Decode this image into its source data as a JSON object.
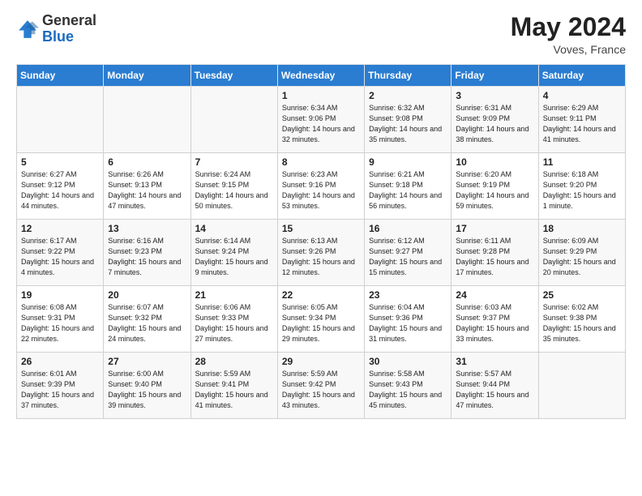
{
  "header": {
    "logo_general": "General",
    "logo_blue": "Blue",
    "month_year": "May 2024",
    "location": "Voves, France"
  },
  "days_of_week": [
    "Sunday",
    "Monday",
    "Tuesday",
    "Wednesday",
    "Thursday",
    "Friday",
    "Saturday"
  ],
  "weeks": [
    [
      {
        "day": null,
        "sunrise": null,
        "sunset": null,
        "daylight": null
      },
      {
        "day": null,
        "sunrise": null,
        "sunset": null,
        "daylight": null
      },
      {
        "day": null,
        "sunrise": null,
        "sunset": null,
        "daylight": null
      },
      {
        "day": 1,
        "sunrise": "Sunrise: 6:34 AM",
        "sunset": "Sunset: 9:06 PM",
        "daylight": "Daylight: 14 hours and 32 minutes."
      },
      {
        "day": 2,
        "sunrise": "Sunrise: 6:32 AM",
        "sunset": "Sunset: 9:08 PM",
        "daylight": "Daylight: 14 hours and 35 minutes."
      },
      {
        "day": 3,
        "sunrise": "Sunrise: 6:31 AM",
        "sunset": "Sunset: 9:09 PM",
        "daylight": "Daylight: 14 hours and 38 minutes."
      },
      {
        "day": 4,
        "sunrise": "Sunrise: 6:29 AM",
        "sunset": "Sunset: 9:11 PM",
        "daylight": "Daylight: 14 hours and 41 minutes."
      }
    ],
    [
      {
        "day": 5,
        "sunrise": "Sunrise: 6:27 AM",
        "sunset": "Sunset: 9:12 PM",
        "daylight": "Daylight: 14 hours and 44 minutes."
      },
      {
        "day": 6,
        "sunrise": "Sunrise: 6:26 AM",
        "sunset": "Sunset: 9:13 PM",
        "daylight": "Daylight: 14 hours and 47 minutes."
      },
      {
        "day": 7,
        "sunrise": "Sunrise: 6:24 AM",
        "sunset": "Sunset: 9:15 PM",
        "daylight": "Daylight: 14 hours and 50 minutes."
      },
      {
        "day": 8,
        "sunrise": "Sunrise: 6:23 AM",
        "sunset": "Sunset: 9:16 PM",
        "daylight": "Daylight: 14 hours and 53 minutes."
      },
      {
        "day": 9,
        "sunrise": "Sunrise: 6:21 AM",
        "sunset": "Sunset: 9:18 PM",
        "daylight": "Daylight: 14 hours and 56 minutes."
      },
      {
        "day": 10,
        "sunrise": "Sunrise: 6:20 AM",
        "sunset": "Sunset: 9:19 PM",
        "daylight": "Daylight: 14 hours and 59 minutes."
      },
      {
        "day": 11,
        "sunrise": "Sunrise: 6:18 AM",
        "sunset": "Sunset: 9:20 PM",
        "daylight": "Daylight: 15 hours and 1 minute."
      }
    ],
    [
      {
        "day": 12,
        "sunrise": "Sunrise: 6:17 AM",
        "sunset": "Sunset: 9:22 PM",
        "daylight": "Daylight: 15 hours and 4 minutes."
      },
      {
        "day": 13,
        "sunrise": "Sunrise: 6:16 AM",
        "sunset": "Sunset: 9:23 PM",
        "daylight": "Daylight: 15 hours and 7 minutes."
      },
      {
        "day": 14,
        "sunrise": "Sunrise: 6:14 AM",
        "sunset": "Sunset: 9:24 PM",
        "daylight": "Daylight: 15 hours and 9 minutes."
      },
      {
        "day": 15,
        "sunrise": "Sunrise: 6:13 AM",
        "sunset": "Sunset: 9:26 PM",
        "daylight": "Daylight: 15 hours and 12 minutes."
      },
      {
        "day": 16,
        "sunrise": "Sunrise: 6:12 AM",
        "sunset": "Sunset: 9:27 PM",
        "daylight": "Daylight: 15 hours and 15 minutes."
      },
      {
        "day": 17,
        "sunrise": "Sunrise: 6:11 AM",
        "sunset": "Sunset: 9:28 PM",
        "daylight": "Daylight: 15 hours and 17 minutes."
      },
      {
        "day": 18,
        "sunrise": "Sunrise: 6:09 AM",
        "sunset": "Sunset: 9:29 PM",
        "daylight": "Daylight: 15 hours and 20 minutes."
      }
    ],
    [
      {
        "day": 19,
        "sunrise": "Sunrise: 6:08 AM",
        "sunset": "Sunset: 9:31 PM",
        "daylight": "Daylight: 15 hours and 22 minutes."
      },
      {
        "day": 20,
        "sunrise": "Sunrise: 6:07 AM",
        "sunset": "Sunset: 9:32 PM",
        "daylight": "Daylight: 15 hours and 24 minutes."
      },
      {
        "day": 21,
        "sunrise": "Sunrise: 6:06 AM",
        "sunset": "Sunset: 9:33 PM",
        "daylight": "Daylight: 15 hours and 27 minutes."
      },
      {
        "day": 22,
        "sunrise": "Sunrise: 6:05 AM",
        "sunset": "Sunset: 9:34 PM",
        "daylight": "Daylight: 15 hours and 29 minutes."
      },
      {
        "day": 23,
        "sunrise": "Sunrise: 6:04 AM",
        "sunset": "Sunset: 9:36 PM",
        "daylight": "Daylight: 15 hours and 31 minutes."
      },
      {
        "day": 24,
        "sunrise": "Sunrise: 6:03 AM",
        "sunset": "Sunset: 9:37 PM",
        "daylight": "Daylight: 15 hours and 33 minutes."
      },
      {
        "day": 25,
        "sunrise": "Sunrise: 6:02 AM",
        "sunset": "Sunset: 9:38 PM",
        "daylight": "Daylight: 15 hours and 35 minutes."
      }
    ],
    [
      {
        "day": 26,
        "sunrise": "Sunrise: 6:01 AM",
        "sunset": "Sunset: 9:39 PM",
        "daylight": "Daylight: 15 hours and 37 minutes."
      },
      {
        "day": 27,
        "sunrise": "Sunrise: 6:00 AM",
        "sunset": "Sunset: 9:40 PM",
        "daylight": "Daylight: 15 hours and 39 minutes."
      },
      {
        "day": 28,
        "sunrise": "Sunrise: 5:59 AM",
        "sunset": "Sunset: 9:41 PM",
        "daylight": "Daylight: 15 hours and 41 minutes."
      },
      {
        "day": 29,
        "sunrise": "Sunrise: 5:59 AM",
        "sunset": "Sunset: 9:42 PM",
        "daylight": "Daylight: 15 hours and 43 minutes."
      },
      {
        "day": 30,
        "sunrise": "Sunrise: 5:58 AM",
        "sunset": "Sunset: 9:43 PM",
        "daylight": "Daylight: 15 hours and 45 minutes."
      },
      {
        "day": 31,
        "sunrise": "Sunrise: 5:57 AM",
        "sunset": "Sunset: 9:44 PM",
        "daylight": "Daylight: 15 hours and 47 minutes."
      },
      {
        "day": null,
        "sunrise": null,
        "sunset": null,
        "daylight": null
      }
    ]
  ]
}
